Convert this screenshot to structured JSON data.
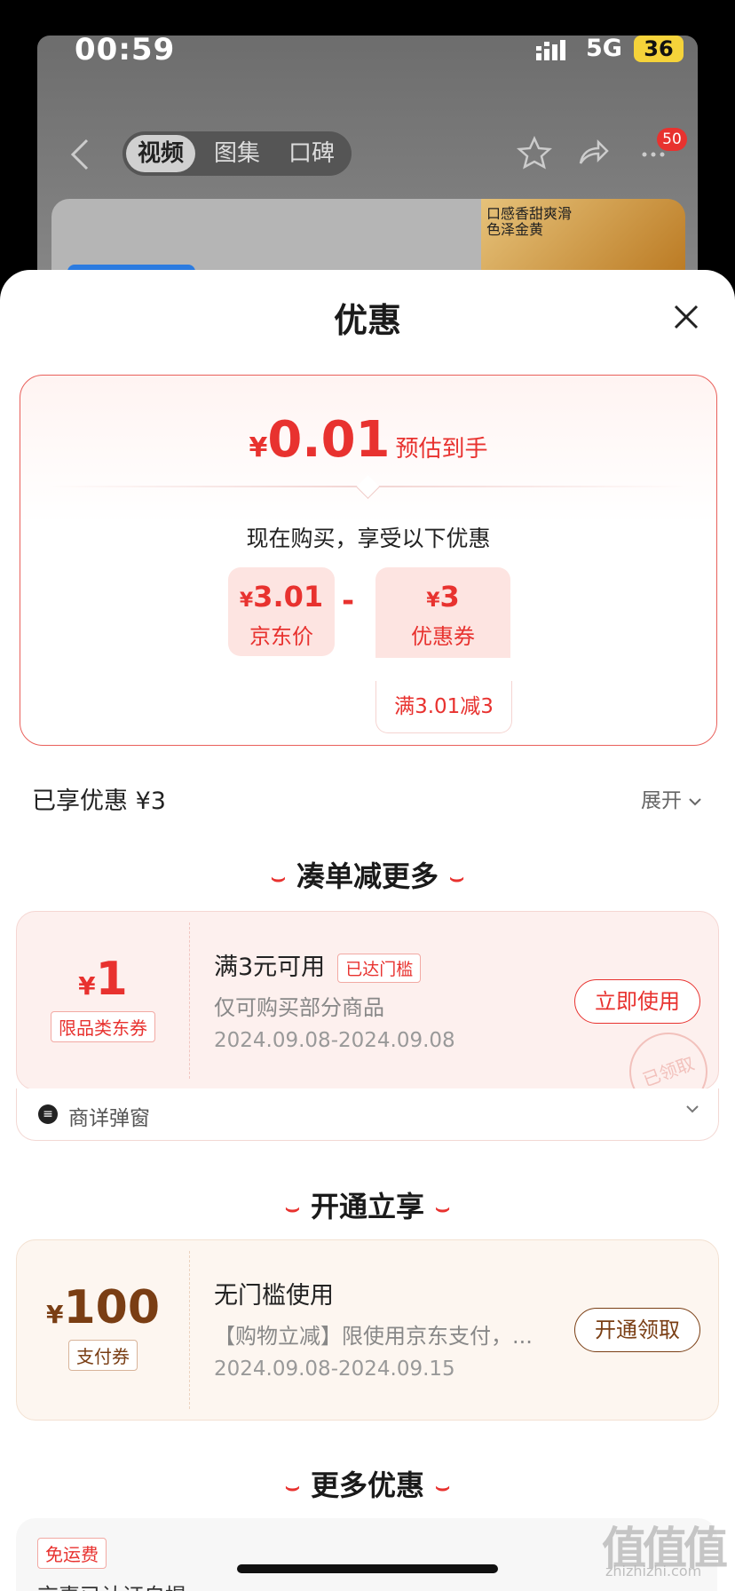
{
  "status": {
    "time": "00:59",
    "network": "5G",
    "battery": "36"
  },
  "nav": {
    "tabs": [
      {
        "label": "视频",
        "active": true
      },
      {
        "label": "图集"
      },
      {
        "label": "口碑"
      }
    ],
    "badge": "50"
  },
  "background": {
    "image_caption": "口感香甜爽滑 色泽金黄"
  },
  "sheet": {
    "title": "优惠",
    "summary": {
      "currency": "¥",
      "estimate_amount": "0.01",
      "estimate_label": "预估到手",
      "buy_now_text": "现在购买，享受以下优惠",
      "price": {
        "currency": "¥",
        "value": "3.01",
        "label": "京东价"
      },
      "minus": "-",
      "coupon": {
        "currency": "¥",
        "value": "3",
        "label": "优惠券",
        "rule": "满3.01减3"
      }
    },
    "enjoyed": "已享优惠 ¥3",
    "expand": "展开",
    "sections": {
      "combine": "凑单减更多",
      "open": "开通立享",
      "more": "更多优惠"
    },
    "section_mark": "⌣",
    "coupon1": {
      "currency": "¥",
      "amount": "1",
      "tag": "限品类东券",
      "title": "满3元可用",
      "reach_tag": "已达门槛",
      "desc": "仅可购买部分商品",
      "date": "2024.09.08-2024.09.08",
      "button": "立即使用",
      "stamp": "已领取",
      "accent": "#e8322f"
    },
    "popup": {
      "label": "商详弹窗"
    },
    "coupon2": {
      "currency": "¥",
      "amount": "100",
      "tag": "支付券",
      "title": "无门槛使用",
      "desc": "【购物立减】限使用京东支付，...",
      "date": "2024.09.08-2024.09.15",
      "button": "开通领取",
      "accent": "#7a3e14"
    },
    "more_card": {
      "tag": "免运费",
      "text": "京喜已认证自提"
    }
  },
  "watermark": {
    "text": "值值值",
    "sub": "zhizhizhi.com"
  }
}
